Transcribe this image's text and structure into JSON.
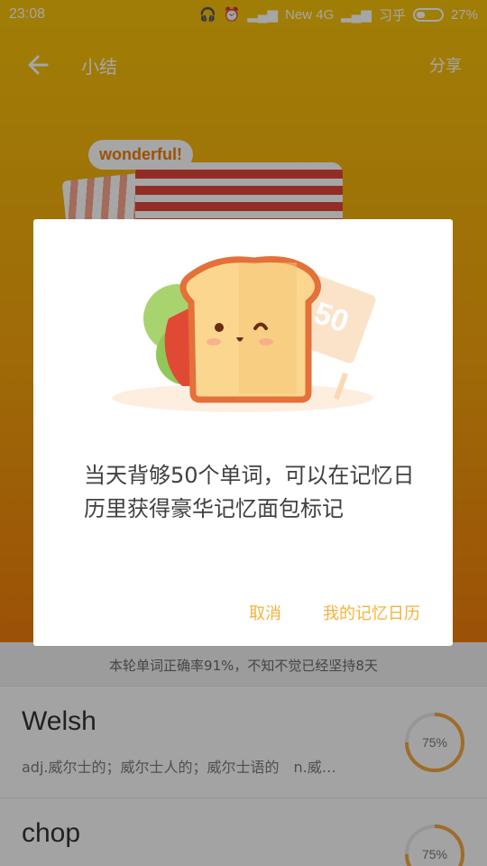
{
  "statusbar": {
    "time": "23:08",
    "network": "New 4G",
    "carrier": "习乎",
    "battery": "27%"
  },
  "appbar": {
    "title": "小结",
    "share_label": "分享"
  },
  "decor": {
    "badge": "wonderful!"
  },
  "dialog": {
    "sign_number": "50",
    "message": "当天背够50个单词，可以在记忆日历里获得豪华记忆面包标记",
    "cancel_label": "取消",
    "calendar_label": "我的记忆日历"
  },
  "summary": {
    "text": "本轮单词正确率91%，不知不觉已经坚持8天"
  },
  "words": [
    {
      "word": "Welsh",
      "definition": "adj.威尔士的；威尔士人的；威尔士语的　n.威…",
      "progress": "75%"
    },
    {
      "word": "chop",
      "definition": "",
      "progress": "75%"
    }
  ],
  "colors": {
    "accent": "#f4b33a",
    "hero_top": "#f6c20a",
    "hero_bottom": "#ef7d0a",
    "progress_ring": "#f4a640"
  }
}
